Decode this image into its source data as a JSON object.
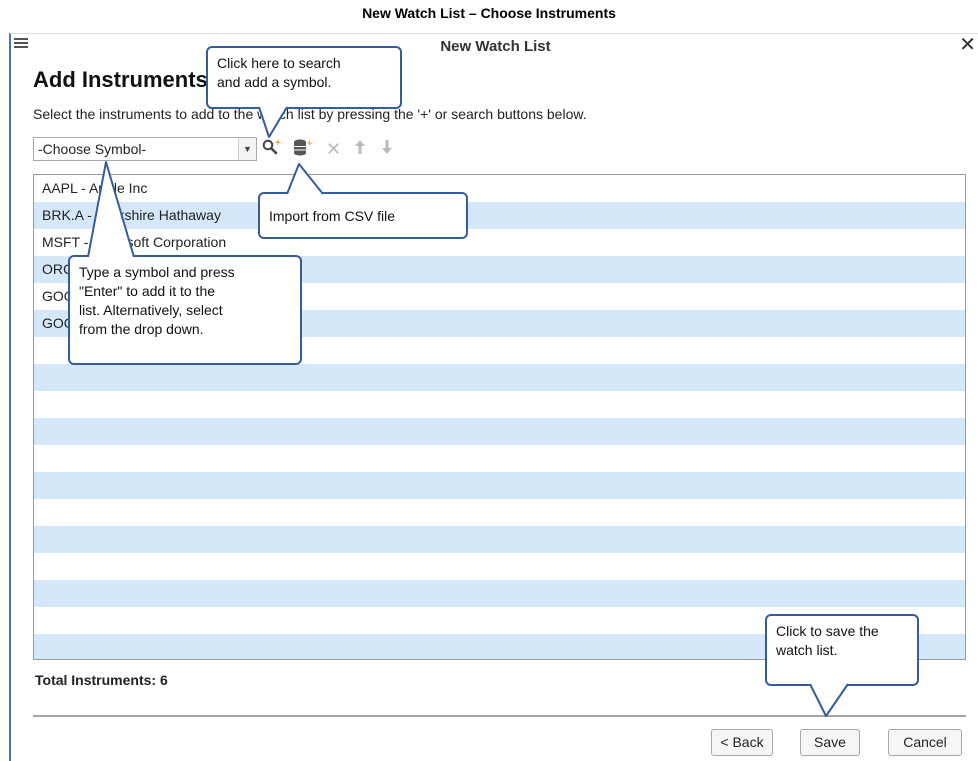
{
  "caption": "New Watch List – Choose Instruments",
  "dialog": {
    "title": "New Watch List",
    "close_glyph": "✕",
    "heading": "Add Instruments",
    "instructions": "Select the instruments to add to the watch list by pressing the '+' or search buttons below.",
    "symbol_select": {
      "value": "-Choose Symbol-"
    },
    "toolbar": {
      "search_icon": "search-add-icon",
      "import_icon": "database-add-icon",
      "remove_glyph": "✕",
      "up_glyph": "🡑",
      "down_glyph": "🡓"
    },
    "instruments": [
      {
        "label": "AAPL - Apple Inc"
      },
      {
        "label": "BRK.A - Berkshire Hathaway"
      },
      {
        "label": "MSFT - Microsoft Corporation"
      },
      {
        "label": "ORCL"
      },
      {
        "label": "GOOG"
      },
      {
        "label": "GOOGL"
      }
    ],
    "total_label": "Total Instruments: 6",
    "buttons": {
      "back": "< Back",
      "save": "Save",
      "cancel": "Cancel"
    }
  },
  "callouts": {
    "search": "Click here to search\nand add a symbol.",
    "import": "Import from CSV file",
    "type": "Type a symbol and press\n\"Enter\" to add it to the\nlist.  Alternatively, select\nfrom the drop down.",
    "save": "Click to save the\nwatch list."
  },
  "colors": {
    "accent": "#4a74b4",
    "row_stripe": "#d5e8f9",
    "callout_border": "#355d9c"
  }
}
